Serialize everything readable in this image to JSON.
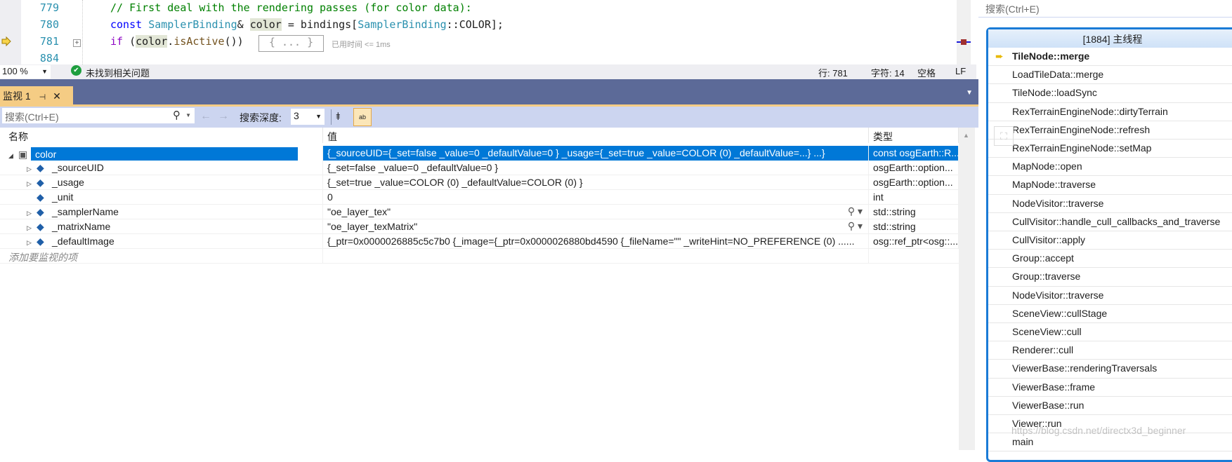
{
  "editor": {
    "lines": [
      {
        "num": "779",
        "text": "// First deal with the rendering passes (for color data):"
      },
      {
        "num": "780",
        "text": "const SamplerBinding& color = bindings[SamplerBinding::COLOR];"
      },
      {
        "num": "781",
        "text": "if (color.isActive())"
      },
      {
        "num": "884",
        "text": ""
      }
    ],
    "collapsed_block": "{ ... }",
    "elapsed": "已用时间 <= 1ms"
  },
  "statusbar": {
    "zoom": "100 %",
    "issues": "未找到相关问题",
    "line": "行: 781",
    "char": "字符: 14",
    "spacing": "空格",
    "eol": "LF"
  },
  "watch": {
    "tab_label": "监视 1",
    "search_placeholder": "搜索(Ctrl+E)",
    "depth_label": "搜索深度:",
    "depth_value": "3",
    "columns": [
      "名称",
      "值",
      "类型"
    ],
    "rows": [
      {
        "name": "color",
        "value": "{_sourceUID={_set=false _value=0 _defaultValue=0 } _usage={_set=true _value=COLOR (0) _defaultValue=...} ...}",
        "type": "const osgEarth::R...",
        "expanded": true,
        "selected": true
      },
      {
        "name": "_sourceUID",
        "value": "{_set=false _value=0 _defaultValue=0 }",
        "type": "osgEarth::option..."
      },
      {
        "name": "_usage",
        "value": "{_set=true _value=COLOR (0) _defaultValue=COLOR (0) }",
        "type": "osgEarth::option..."
      },
      {
        "name": "_unit",
        "value": "0",
        "type": "int"
      },
      {
        "name": "_samplerName",
        "value": "\"oe_layer_tex\"",
        "type": "std::string"
      },
      {
        "name": "_matrixName",
        "value": "\"oe_layer_texMatrix\"",
        "type": "std::string"
      },
      {
        "name": "_defaultImage",
        "value": "{_ptr=0x0000026885c5c7b0 {_image={_ptr=0x0000026880bd4590 {_fileName=\"\" _writeHint=NO_PREFERENCE (0) ......",
        "type": "osg::ref_ptr<osg::..."
      }
    ],
    "add_item_placeholder": "添加要监视的项"
  },
  "callstack": {
    "search_placeholder": "搜索(Ctrl+E)",
    "thread_title": "[1884] 主线程",
    "frames": [
      "TileNode::merge",
      "LoadTileData::merge",
      "TileNode::loadSync",
      "RexTerrainEngineNode::dirtyTerrain",
      "RexTerrainEngineNode::refresh",
      "RexTerrainEngineNode::setMap",
      "MapNode::open",
      "MapNode::traverse",
      "NodeVisitor::traverse",
      "CullVisitor::handle_cull_callbacks_and_traverse",
      "CullVisitor::apply",
      "Group::accept",
      "Group::traverse",
      "NodeVisitor::traverse",
      "SceneView::cullStage",
      "SceneView::cull",
      "Renderer::cull",
      "ViewerBase::renderingTraversals",
      "ViewerBase::frame",
      "ViewerBase::run",
      "Viewer::run",
      "main"
    ]
  },
  "watermark": "https://blog.csdn.net/directx3d_beginner",
  "colors": {
    "accent": "#0078d7",
    "panel_band": "#5c6a98",
    "tab_active": "#f5cc84",
    "toolbar": "#ccd5f0"
  }
}
